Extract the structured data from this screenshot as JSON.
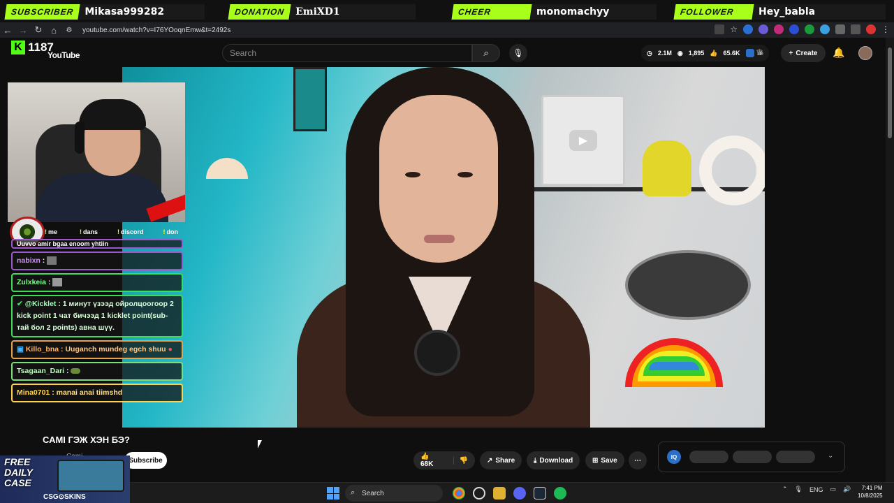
{
  "alerts": [
    {
      "tag": "SUBSCRIBER",
      "name": "Mikasa999282",
      "tag_color": "#a8ff1a"
    },
    {
      "tag": "DONATION",
      "name": "EmiXD1",
      "tag_color": "#a8ff1a"
    },
    {
      "tag": "CHEER",
      "name": "monomachyy",
      "tag_color": "#a8ff1a"
    },
    {
      "tag": "FOLLOWER",
      "name": "Hey_babla",
      "tag_color": "#a8ff1a"
    }
  ],
  "browser": {
    "url": "youtube.com/watch?v=I76YOoqnEmw&t=2492s"
  },
  "youtube": {
    "kick_count": "1187",
    "logo_text": "YouTube",
    "search_placeholder": "Search",
    "stats": {
      "views": "2.1M",
      "viewers": "1,895",
      "likes": "65.6K"
    },
    "create_label": "Create"
  },
  "stream_links": [
    "me",
    "dans",
    "discord",
    "don"
  ],
  "chat": [
    {
      "name": "",
      "text": "Uuvvo amir bgaa enoom yhtiin",
      "border": "#9b59d0",
      "name_color": "#fff"
    },
    {
      "name": "nabixn",
      "text": ":",
      "border": "#9b59d0",
      "name_color": "#d08cff"
    },
    {
      "name": "Zulxkeia",
      "text": ":",
      "border": "#3fdc5a",
      "name_color": "#7dff8a"
    },
    {
      "name": "@Kicklet",
      "text": ": 1 минут үзээд ойролцоогоор 2 kick point 1 чат бичээд 1 kicklet point(sub-тай бол 2 points) авна шүү.",
      "border": "#3fdc5a",
      "name_color": "#9dffb0"
    },
    {
      "name": "Killo_bna",
      "text": ": Uuganch mundeg egch shuu",
      "border": "#e8a04a",
      "name_color": "#ffb466"
    },
    {
      "name": "Tsagaan_Dari",
      "text": ":",
      "border": "#7be07b",
      "name_color": "#b5ffb5"
    },
    {
      "name": "Mina0701",
      "text": ": manai anai tiimshd",
      "border": "#ffd24a",
      "name_color": "#ffd24a"
    }
  ],
  "video": {
    "title": "САМІ ГЭЖ ХЭН БЭ?",
    "channel": "Cami",
    "subscribe_label": "Subscribe",
    "likes": "68K",
    "share_label": "Share",
    "download_label": "Download",
    "save_label": "Save"
  },
  "promo": {
    "line1": "FREE",
    "line2": "DAILY",
    "line3": "CASE",
    "brand": "CSG⊙SKINS"
  },
  "taskbar": {
    "search": "Search",
    "lang": "ENG",
    "time": "7:41 PM",
    "date": "10/8/2025"
  }
}
